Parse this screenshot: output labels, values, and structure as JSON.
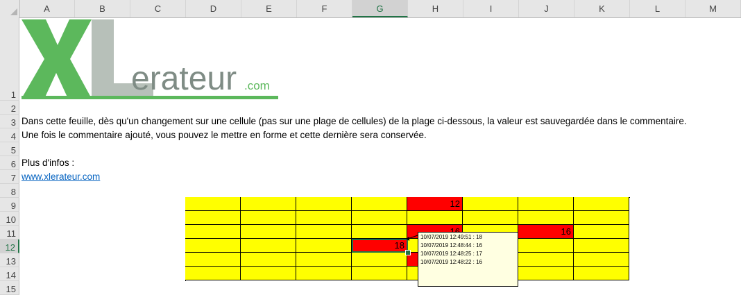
{
  "columns": [
    "A",
    "B",
    "C",
    "D",
    "E",
    "F",
    "G",
    "H",
    "I",
    "J",
    "K",
    "L",
    "M"
  ],
  "selected_column": "G",
  "rows": [
    "1",
    "2",
    "3",
    "4",
    "5",
    "6",
    "7",
    "8",
    "9",
    "10",
    "11",
    "12",
    "13",
    "14",
    "15"
  ],
  "selected_row": "12",
  "logo": {
    "main": "XL",
    "rest": "erateur",
    "suffix": ".com",
    "colors": {
      "x": "#5cb85c",
      "l": "#b7c0b9",
      "text": "#7f8c85",
      "com": "#5cb85c"
    }
  },
  "sheet_text": {
    "line1": "Dans cette feuille, dès qu'un changement sur une cellule (pas sur une plage de cellules) de la plage ci-dessous, la valeur est sauvegardée dans le commentaire.",
    "line2": "Une fois le commentaire ajouté, vous pouvez le mettre en forme et cette dernière sera conservée.",
    "line3": "Plus d'infos :",
    "link": "www.xlerateur.com"
  },
  "table": {
    "rows": [
      [
        "",
        "",
        "",
        "",
        "12",
        "",
        "",
        ""
      ],
      [
        "",
        "",
        "",
        "",
        "",
        "",
        "",
        ""
      ],
      [
        "",
        "",
        "",
        "",
        "16",
        "",
        "16",
        ""
      ],
      [
        "",
        "",
        "",
        "18",
        "",
        "",
        "",
        ""
      ],
      [
        "",
        "",
        "",
        "",
        "",
        "",
        "",
        ""
      ],
      [
        "",
        "",
        "",
        "",
        "",
        "",
        "",
        ""
      ]
    ],
    "red": [
      [
        0,
        4
      ],
      [
        2,
        4
      ],
      [
        2,
        6
      ],
      [
        3,
        3
      ],
      [
        4,
        4
      ]
    ],
    "colors": {
      "fill": "#ffff00",
      "highlight": "#ff0000",
      "selection": "#217346"
    }
  },
  "comment": {
    "lines": [
      "10/07/2019 12:49:51 : 18",
      "10/07/2019 12:48:44 : 16",
      "10/07/2019 12:48:25 : 17",
      "10/07/2019 12:48:22 : 16"
    ]
  }
}
